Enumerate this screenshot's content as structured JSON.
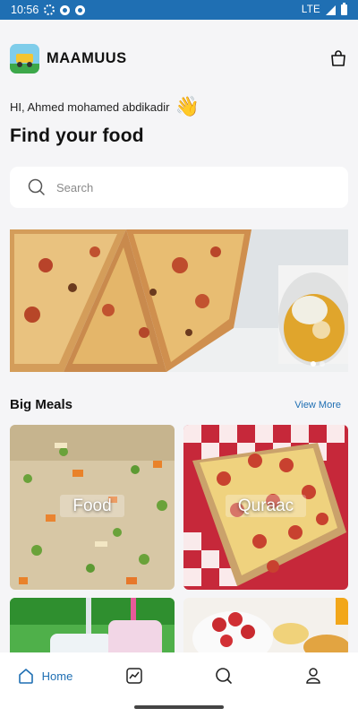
{
  "status_bar": {
    "time": "10:56",
    "network": "LTE"
  },
  "header": {
    "brand": "MAAMUUS"
  },
  "greeting": {
    "text": "HI, Ahmed mohamed abdikadir",
    "emoji": "👋"
  },
  "title": "Find your food",
  "search": {
    "placeholder": "Search",
    "value": ""
  },
  "banner": {
    "slides": 2,
    "active_slide": 1
  },
  "section": {
    "title": "Big Meals",
    "view_more": "View More"
  },
  "cards": [
    {
      "label": "Food"
    },
    {
      "label": "Quraac"
    },
    {
      "label": ""
    },
    {
      "label": ""
    }
  ],
  "bottom_nav": {
    "items": [
      {
        "label": "Home",
        "icon": "home-icon",
        "active": true
      },
      {
        "label": "",
        "icon": "chart-icon",
        "active": false
      },
      {
        "label": "",
        "icon": "search-icon",
        "active": false
      },
      {
        "label": "",
        "icon": "profile-icon",
        "active": false
      }
    ]
  },
  "colors": {
    "accent": "#1f6fb3",
    "background": "#f5f5f7",
    "status_bar": "#1f6fb3"
  }
}
